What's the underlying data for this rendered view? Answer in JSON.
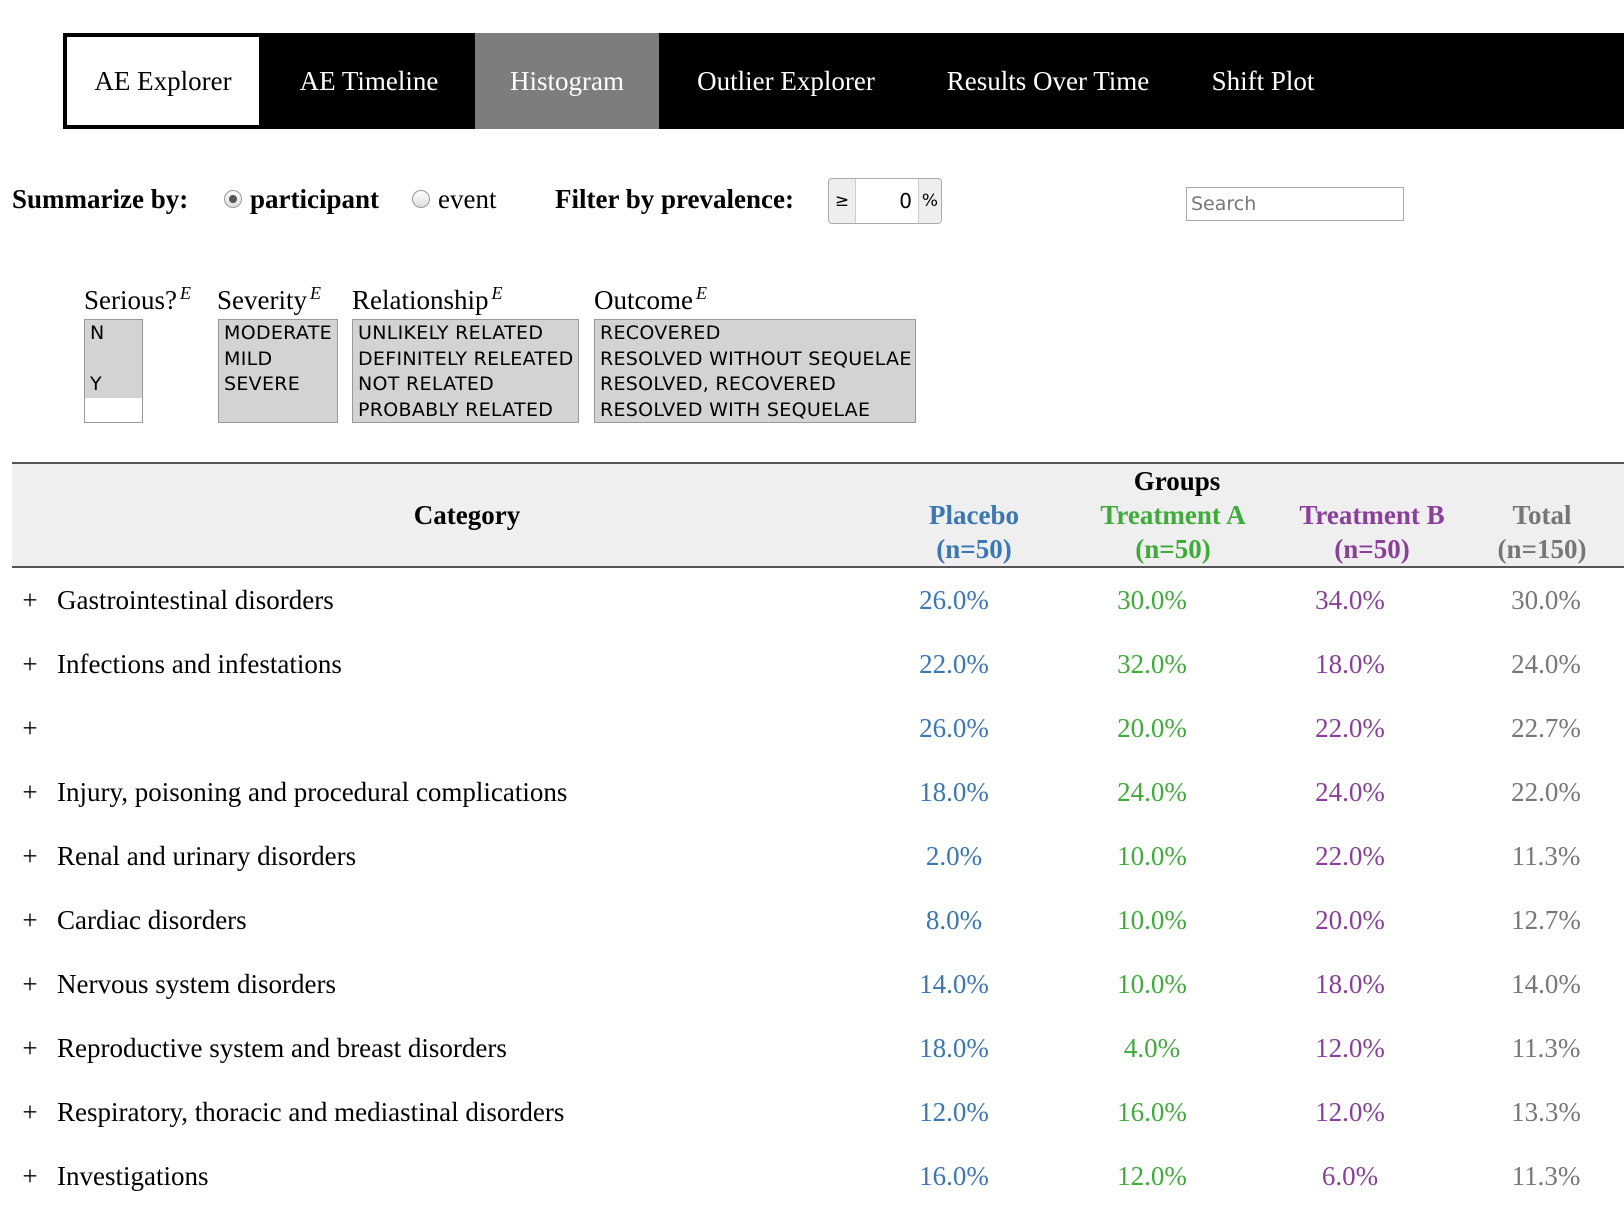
{
  "tabs": [
    {
      "label": "AE Explorer",
      "state": "active"
    },
    {
      "label": "AE Timeline",
      "state": "normal"
    },
    {
      "label": "Histogram",
      "state": "hover"
    },
    {
      "label": "Outlier Explorer",
      "state": "normal"
    },
    {
      "label": "Results Over Time",
      "state": "normal"
    },
    {
      "label": "Shift Plot",
      "state": "normal"
    }
  ],
  "controls": {
    "summarize_label": "Summarize by:",
    "participant_label": "participant",
    "event_label": "event",
    "summarize_selected": "participant",
    "filter_label": "Filter by prevalence:",
    "operator": "≥",
    "prevalence_value": "0",
    "percent_symbol": "%",
    "search_placeholder": "Search"
  },
  "filters": {
    "serious": {
      "title": "Serious?",
      "marker": "E",
      "options": [
        "N",
        "",
        "Y"
      ]
    },
    "severity": {
      "title": "Severity",
      "marker": "E",
      "options": [
        "MODERATE",
        "MILD",
        "SEVERE"
      ]
    },
    "relationship": {
      "title": "Relationship",
      "marker": "E",
      "options": [
        "UNLIKELY RELATED",
        "DEFINITELY RELEATED",
        "NOT RELATED",
        "PROBABLY RELATED"
      ]
    },
    "outcome": {
      "title": "Outcome",
      "marker": "E",
      "options": [
        "RECOVERED",
        "RESOLVED WITHOUT SEQUELAE",
        "RESOLVED, RECOVERED",
        "RESOLVED WITH SEQUELAE"
      ]
    }
  },
  "table": {
    "category_header": "Category",
    "groups_header": "Groups",
    "columns": [
      {
        "name": "Placebo",
        "n": "(n=50)",
        "color": "#3a77b4"
      },
      {
        "name": "Treatment A",
        "n": "(n=50)",
        "color": "#3fab3a"
      },
      {
        "name": "Treatment B",
        "n": "(n=50)",
        "color": "#8a3f9b"
      },
      {
        "name": "Total",
        "n": "(n=150)",
        "color": "#777777"
      }
    ],
    "expand_symbol": "+",
    "rows": [
      {
        "category": "Gastrointestinal disorders",
        "values": [
          "26.0%",
          "30.0%",
          "34.0%",
          "30.0%"
        ]
      },
      {
        "category": "Infections and infestations",
        "values": [
          "22.0%",
          "32.0%",
          "18.0%",
          "24.0%"
        ]
      },
      {
        "category": "",
        "values": [
          "26.0%",
          "20.0%",
          "22.0%",
          "22.7%"
        ]
      },
      {
        "category": "Injury, poisoning and procedural complications",
        "values": [
          "18.0%",
          "24.0%",
          "24.0%",
          "22.0%"
        ]
      },
      {
        "category": "Renal and urinary disorders",
        "values": [
          "2.0%",
          "10.0%",
          "22.0%",
          "11.3%"
        ]
      },
      {
        "category": "Cardiac disorders",
        "values": [
          "8.0%",
          "10.0%",
          "20.0%",
          "12.7%"
        ]
      },
      {
        "category": "Nervous system disorders",
        "values": [
          "14.0%",
          "10.0%",
          "18.0%",
          "14.0%"
        ]
      },
      {
        "category": "Reproductive system and breast disorders",
        "values": [
          "18.0%",
          "4.0%",
          "12.0%",
          "11.3%"
        ]
      },
      {
        "category": "Respiratory, thoracic and mediastinal disorders",
        "values": [
          "12.0%",
          "16.0%",
          "12.0%",
          "13.3%"
        ]
      },
      {
        "category": "Investigations",
        "values": [
          "16.0%",
          "12.0%",
          "6.0%",
          "11.3%"
        ]
      }
    ]
  }
}
